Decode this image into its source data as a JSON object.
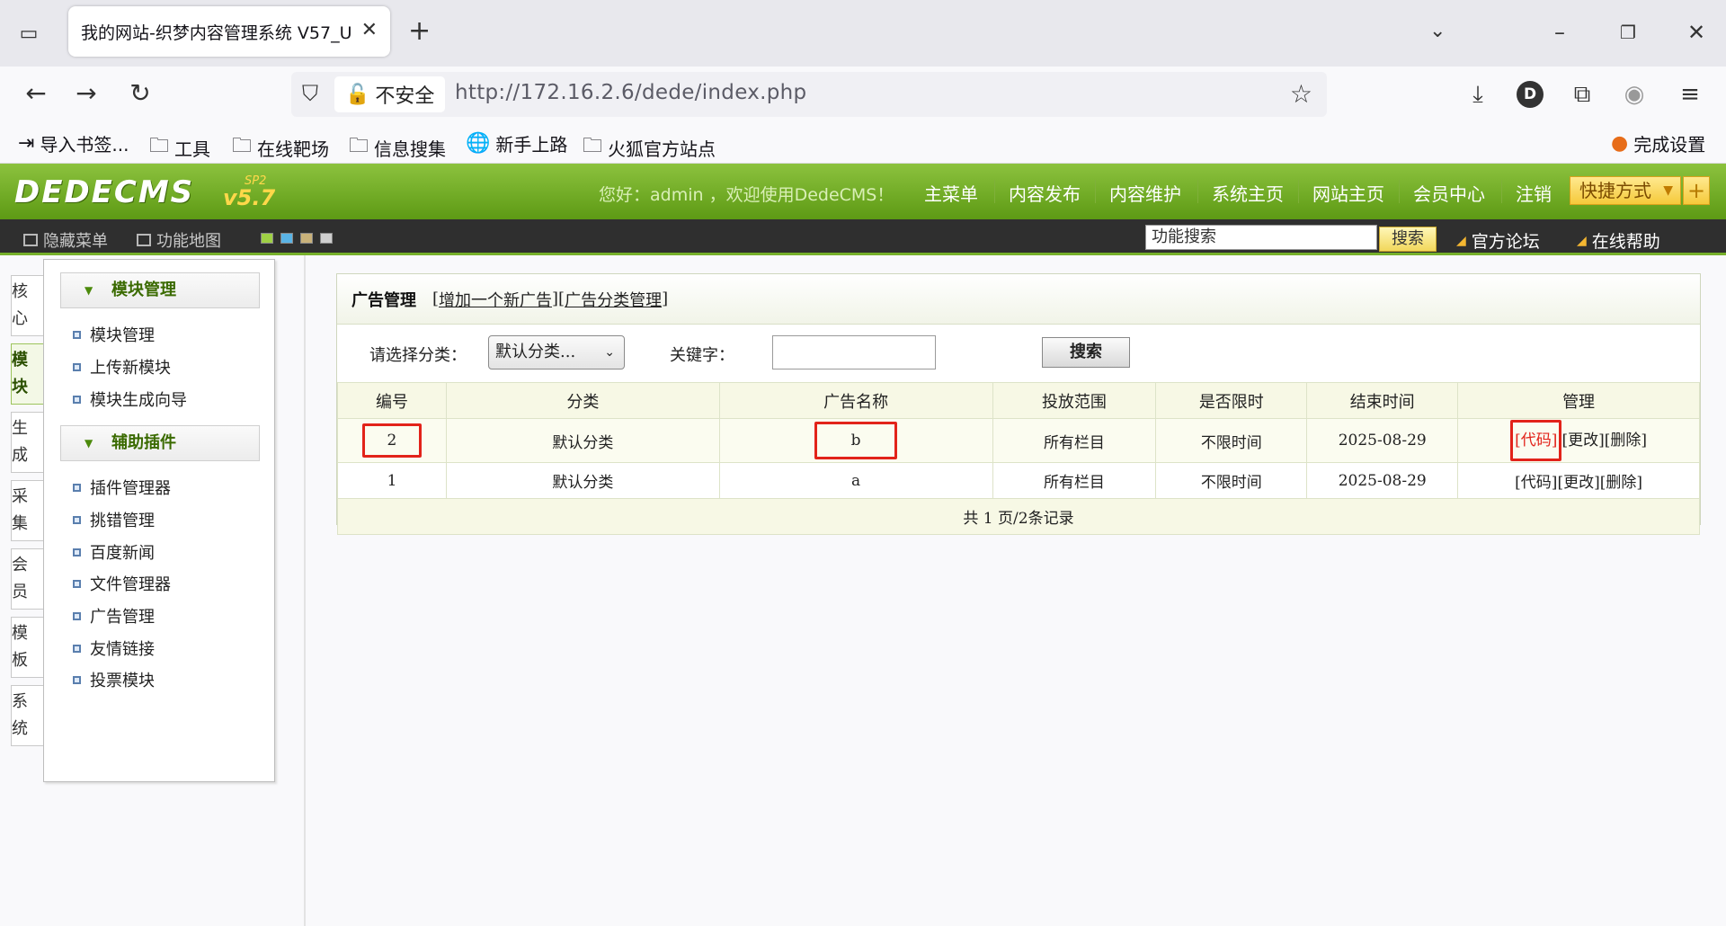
{
  "browser": {
    "tab_title": "我的网站-织梦内容管理系统 V57_U",
    "security_label": "不安全",
    "url": "http://172.16.2.6/dede/index.php",
    "profile_initial": "D",
    "bookmarks": [
      "导入书签...",
      "工具",
      "在线靶场",
      "信息搜集",
      "新手上路",
      "火狐官方站点"
    ],
    "finish_setup": "完成设置"
  },
  "cms": {
    "logo": "DEDECMS",
    "logo_version": "v5.7",
    "logo_sp": "SP2",
    "greeting": "您好：admin ，欢迎使用DedeCMS！",
    "topnav": [
      "主菜单",
      "内容发布",
      "内容维护",
      "系统主页",
      "网站主页",
      "会员中心",
      "注销"
    ],
    "quick": "快捷方式",
    "bar": {
      "hide_menu": "隐藏菜单",
      "func_map": "功能地图",
      "search_value": "功能搜索",
      "search_btn": "搜索",
      "forum": "官方论坛",
      "help": "在线帮助"
    },
    "side_tabs": [
      "核心",
      "模块",
      "生成",
      "采集",
      "会员",
      "模板",
      "系统"
    ],
    "menu": {
      "group1": "模块管理",
      "group1_items": [
        "模块管理",
        "上传新模块",
        "模块生成向导"
      ],
      "group2": "辅助插件",
      "group2_items": [
        "插件管理器",
        "挑错管理",
        "百度新闻",
        "文件管理器",
        "广告管理",
        "友情链接",
        "投票模块"
      ]
    }
  },
  "main": {
    "title": "广告管理",
    "add_link": "增加一个新广告",
    "cat_link": "广告分类管理",
    "filter_label": "请选择分类：",
    "filter_value": "默认分类...",
    "keyword_label": "关键字：",
    "search_btn": "搜索",
    "columns": [
      "编号",
      "分类",
      "广告名称",
      "投放范围",
      "是否限时",
      "结束时间",
      "管理"
    ],
    "rows": [
      {
        "id": "2",
        "cat": "默认分类",
        "name": "b",
        "scope": "所有栏目",
        "limit": "不限时间",
        "end": "2025-08-29"
      },
      {
        "id": "1",
        "cat": "默认分类",
        "name": "a",
        "scope": "所有栏目",
        "limit": "不限时间",
        "end": "2025-08-29"
      }
    ],
    "ops": {
      "code": "[代码]",
      "edit": "[更改]",
      "del": "[删除]"
    },
    "pager": "共 1 页/2条记录"
  }
}
